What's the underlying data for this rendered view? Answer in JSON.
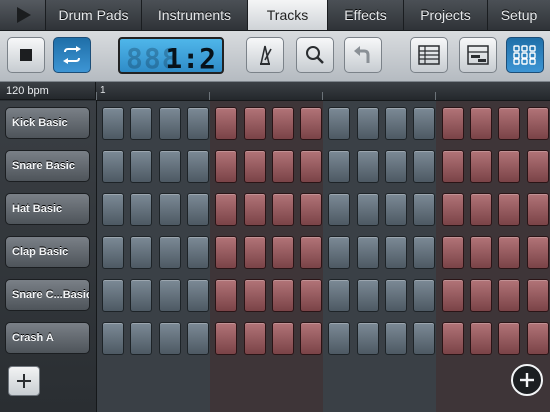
{
  "tabs": [
    {
      "label": "Drum Pads",
      "active": false
    },
    {
      "label": "Instruments",
      "active": false
    },
    {
      "label": "Tracks",
      "active": true
    },
    {
      "label": "Effects",
      "active": false
    },
    {
      "label": "Projects",
      "active": false
    },
    {
      "label": "Setup",
      "active": false
    }
  ],
  "transport": {
    "play_icon": "play-icon",
    "stop_icon": "stop-icon",
    "loop_icon": "loop-icon",
    "loop_enabled": true
  },
  "display": {
    "ghost_digits": "888",
    "value": "1:2"
  },
  "tools": [
    {
      "icon": "metronome-icon"
    },
    {
      "icon": "search-icon"
    },
    {
      "icon": "undo-icon"
    },
    {
      "icon": "list-view-icon"
    },
    {
      "icon": "piano-roll-icon"
    },
    {
      "icon": "pad-grid-icon",
      "selected": true
    }
  ],
  "tempo": "120 bpm",
  "ruler": {
    "bar": "1"
  },
  "tracks": [
    {
      "label": "Kick Basic"
    },
    {
      "label": "Snare Basic"
    },
    {
      "label": "Hat Basic"
    },
    {
      "label": "Clap Basic"
    },
    {
      "label": "Snare C...Basic"
    },
    {
      "label": "Crash A"
    }
  ],
  "steps_visible": 16,
  "step_colors": [
    "blue",
    "blue",
    "blue",
    "blue",
    "red",
    "red",
    "red",
    "red",
    "blue",
    "blue",
    "blue",
    "blue",
    "red",
    "red",
    "red",
    "red"
  ],
  "colors": {
    "accent": "#3d95d4",
    "lcd": "#4fb6ea",
    "pad_blue": "#6b7884",
    "pad_red": "#a0646a"
  },
  "add_track_icon": "plus-icon",
  "add_pattern_icon": "add-circle-icon"
}
